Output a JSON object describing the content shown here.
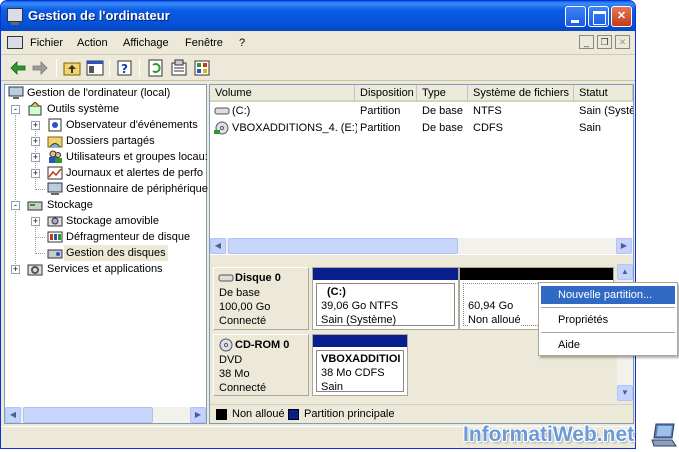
{
  "window": {
    "title": "Gestion de l'ordinateur"
  },
  "menu": {
    "items": [
      "Fichier",
      "Action",
      "Affichage",
      "Fenêtre",
      "?"
    ]
  },
  "toolbar": {
    "icons": [
      "back-icon",
      "forward-icon",
      "up-folder-icon",
      "show-hide-tree-icon",
      "help-icon",
      "refresh-icon",
      "properties-icon",
      "export-icon"
    ]
  },
  "tree": {
    "root": "Gestion de l'ordinateur (local)",
    "nodes": [
      {
        "label": "Outils système",
        "level": 1,
        "expander": "-"
      },
      {
        "label": "Observateur d'événements",
        "level": 2,
        "expander": "+"
      },
      {
        "label": "Dossiers partagés",
        "level": 2,
        "expander": "+"
      },
      {
        "label": "Utilisateurs et groupes locau:",
        "level": 2,
        "expander": "+"
      },
      {
        "label": "Journaux et alertes de perfo",
        "level": 2,
        "expander": "+"
      },
      {
        "label": "Gestionnaire de périphérique",
        "level": 2,
        "expander": ""
      },
      {
        "label": "Stockage",
        "level": 1,
        "expander": "-"
      },
      {
        "label": "Stockage amovible",
        "level": 2,
        "expander": "+"
      },
      {
        "label": "Défragmenteur de disque",
        "level": 2,
        "expander": ""
      },
      {
        "label": "Gestion des disques",
        "level": 2,
        "expander": ""
      },
      {
        "label": "Services et applications",
        "level": 1,
        "expander": "+"
      }
    ]
  },
  "volumes": {
    "columns": [
      "Volume",
      "Disposition",
      "Type",
      "Système de fichiers",
      "Statut"
    ],
    "rows": [
      [
        "(C:)",
        "Partition",
        "De base",
        "NTFS",
        "Sain (Systè"
      ],
      [
        "VBOXADDITIONS_4. (E:)",
        "Partition",
        "De base",
        "CDFS",
        "Sain"
      ]
    ]
  },
  "disks": [
    {
      "name": "Disque 0",
      "type": "De base",
      "size": "100,00 Go",
      "status": "Connecté",
      "partitions": [
        {
          "name": "(C:)",
          "detail": "39,06 Go NTFS",
          "status": "Sain (Système)"
        },
        {
          "name": "",
          "detail": "60,94 Go",
          "status": "Non alloué"
        }
      ]
    },
    {
      "name": "CD-ROM 0",
      "type": "DVD",
      "size": "38 Mo",
      "status": "Connecté",
      "partitions": [
        {
          "name": "VBOXADDITIOI",
          "detail": "38 Mo CDFS",
          "status": "Sain"
        }
      ]
    }
  ],
  "legend": {
    "items": [
      {
        "label": "Non alloué",
        "color": "#000000"
      },
      {
        "label": "Partition principale",
        "color": "#0a1f8e"
      }
    ]
  },
  "context_menu": {
    "items": [
      "Nouvelle partition...",
      "Propriétés",
      "Aide"
    ],
    "highlighted": "Nouvelle partition..."
  },
  "watermark": "InformatiWeb.net",
  "colors": {
    "accent": "#0554d8",
    "primary_partition": "#0a1f8e",
    "highlight": "#316ac5"
  }
}
